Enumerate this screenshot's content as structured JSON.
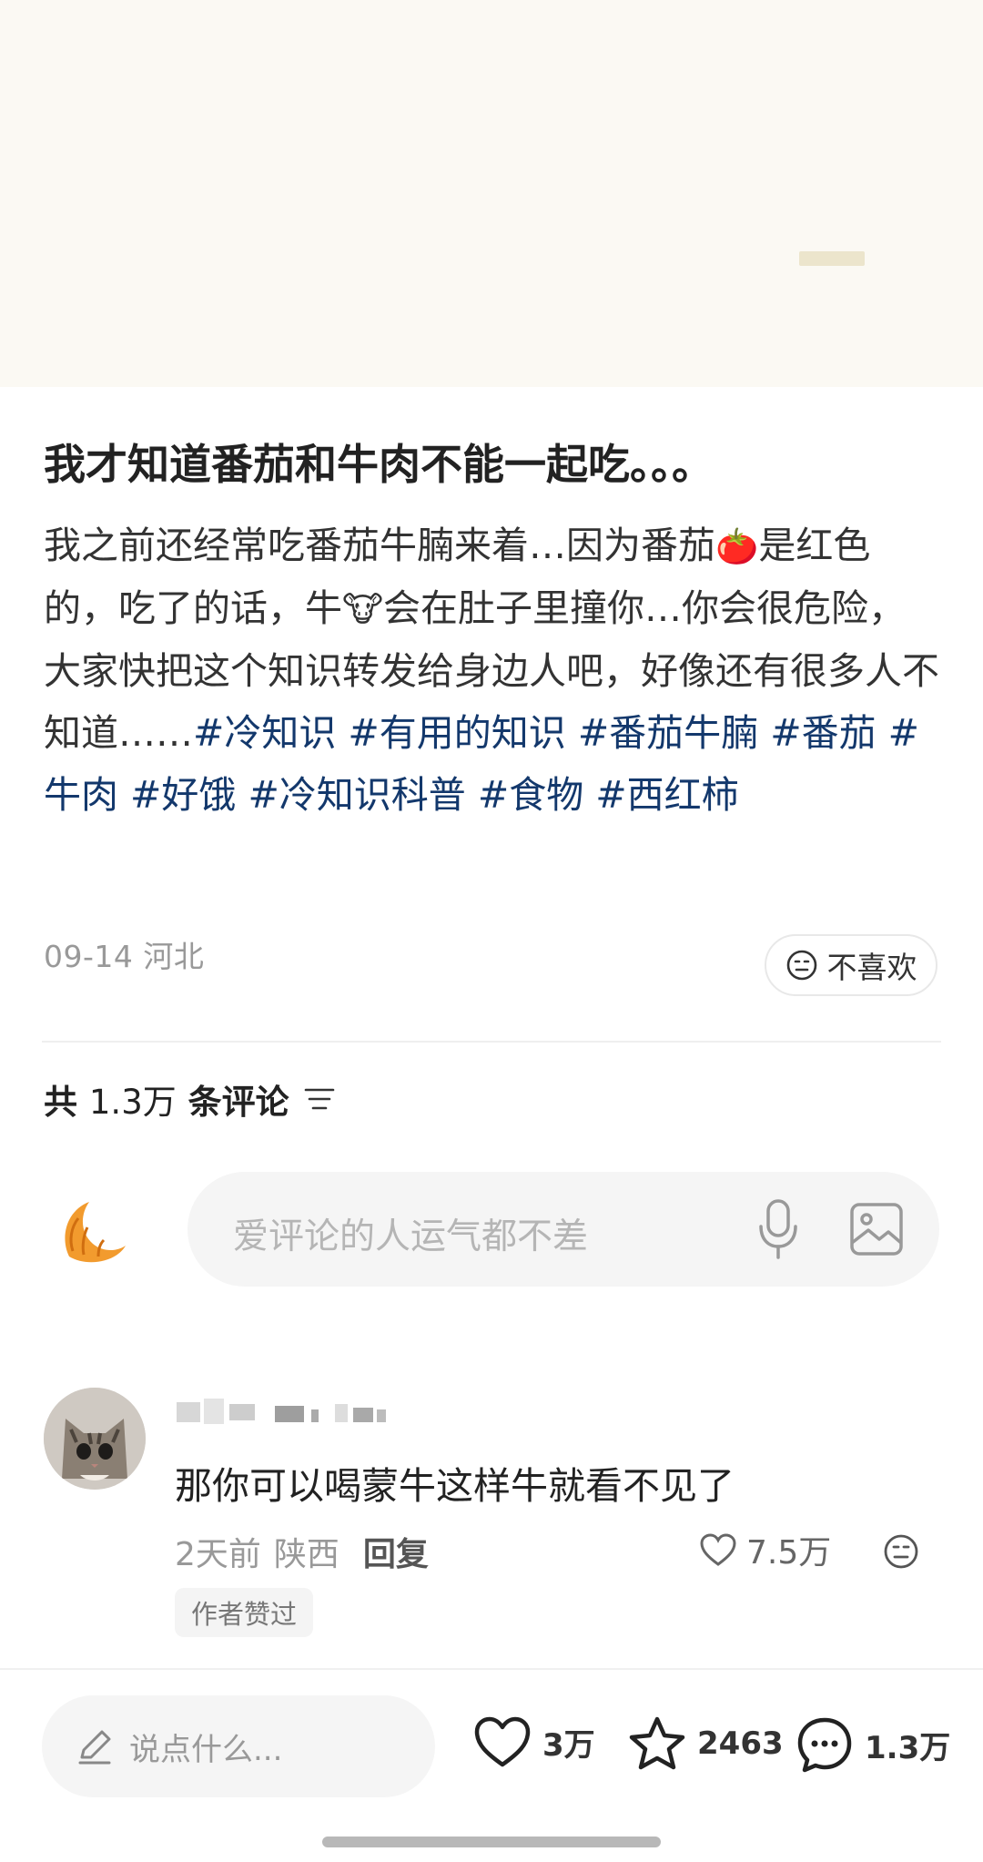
{
  "post": {
    "title": "我才知道番茄和牛肉不能一起吃。。。",
    "body_part1": "我之前还经常吃番茄牛腩来着…因为番茄",
    "emoji_tomato": "🍅",
    "body_part2": "是红色的，吃了的话，牛",
    "emoji_cow": "🐮",
    "body_part3": "会在肚子里撞你…你会很危险，大家快把这个知识转发给身边人吧，好像还有很多人不知道……",
    "tags": [
      "#冷知识",
      "#有用的知识",
      "#番茄牛腩",
      "#番茄",
      "#牛肉",
      "#好饿",
      "#冷知识科普",
      "#食物",
      "#西红柿"
    ],
    "date": "09-14",
    "location": "河北",
    "dislike_label": "不喜欢"
  },
  "comments_header": {
    "prefix": "共",
    "count": "1.3万",
    "suffix": "条评论"
  },
  "comment_input": {
    "placeholder": "爱评论的人运气都不差"
  },
  "comments": [
    {
      "text": "那你可以喝蒙牛这样牛就看不见了",
      "time": "2天前",
      "location": "陕西",
      "reply_label": "回复",
      "likes": "7.5万",
      "badge": "作者赞过"
    }
  ],
  "bottom_bar": {
    "say_placeholder": "说点什么...",
    "like_count": "3万",
    "star_count": "2463",
    "comment_count": "1.3万"
  },
  "icons": [
    "croissant-avatar",
    "microphone-icon",
    "image-icon",
    "heart-icon",
    "star-icon",
    "comment-icon",
    "pencil-icon",
    "sort-icon",
    "neutral-face-icon"
  ],
  "colors": {
    "hashtag": "#13386c",
    "hero_bg": "#fbf9f3",
    "input_bg": "#f5f5f5"
  }
}
